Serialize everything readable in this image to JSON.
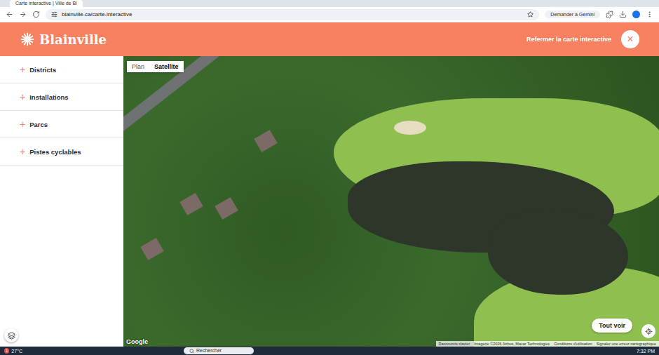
{
  "browser": {
    "tab_title": "Carte interactive | Ville de Bl",
    "url": "blainville.ca/carte-interactive",
    "side_panel": "Demander à Gemini"
  },
  "header": {
    "logo": "Blainville",
    "close_label": "Refermer la carte interactive",
    "close_icon": "×"
  },
  "sidebar": {
    "items": [
      {
        "icon": "+",
        "label": "Districts"
      },
      {
        "icon": "+",
        "label": "Installations"
      },
      {
        "icon": "+",
        "label": "Parcs"
      },
      {
        "icon": "+",
        "label": "Pistes cyclables"
      }
    ]
  },
  "map": {
    "types": [
      {
        "label": "Plan",
        "selected": false
      },
      {
        "label": "Satellite",
        "selected": true
      }
    ],
    "fit_button": "Tout voir",
    "logo": "Google",
    "attribution": [
      "Raccourcis clavier",
      "Imagerie ©2026 Airbus, Maxar Technologies",
      "Conditions d'utilisation",
      "Signaler une erreur cartographique"
    ]
  },
  "taskbar": {
    "weather": "27°C",
    "badge": "1",
    "search_placeholder": "Rechercher",
    "time": "7:32 PM"
  }
}
